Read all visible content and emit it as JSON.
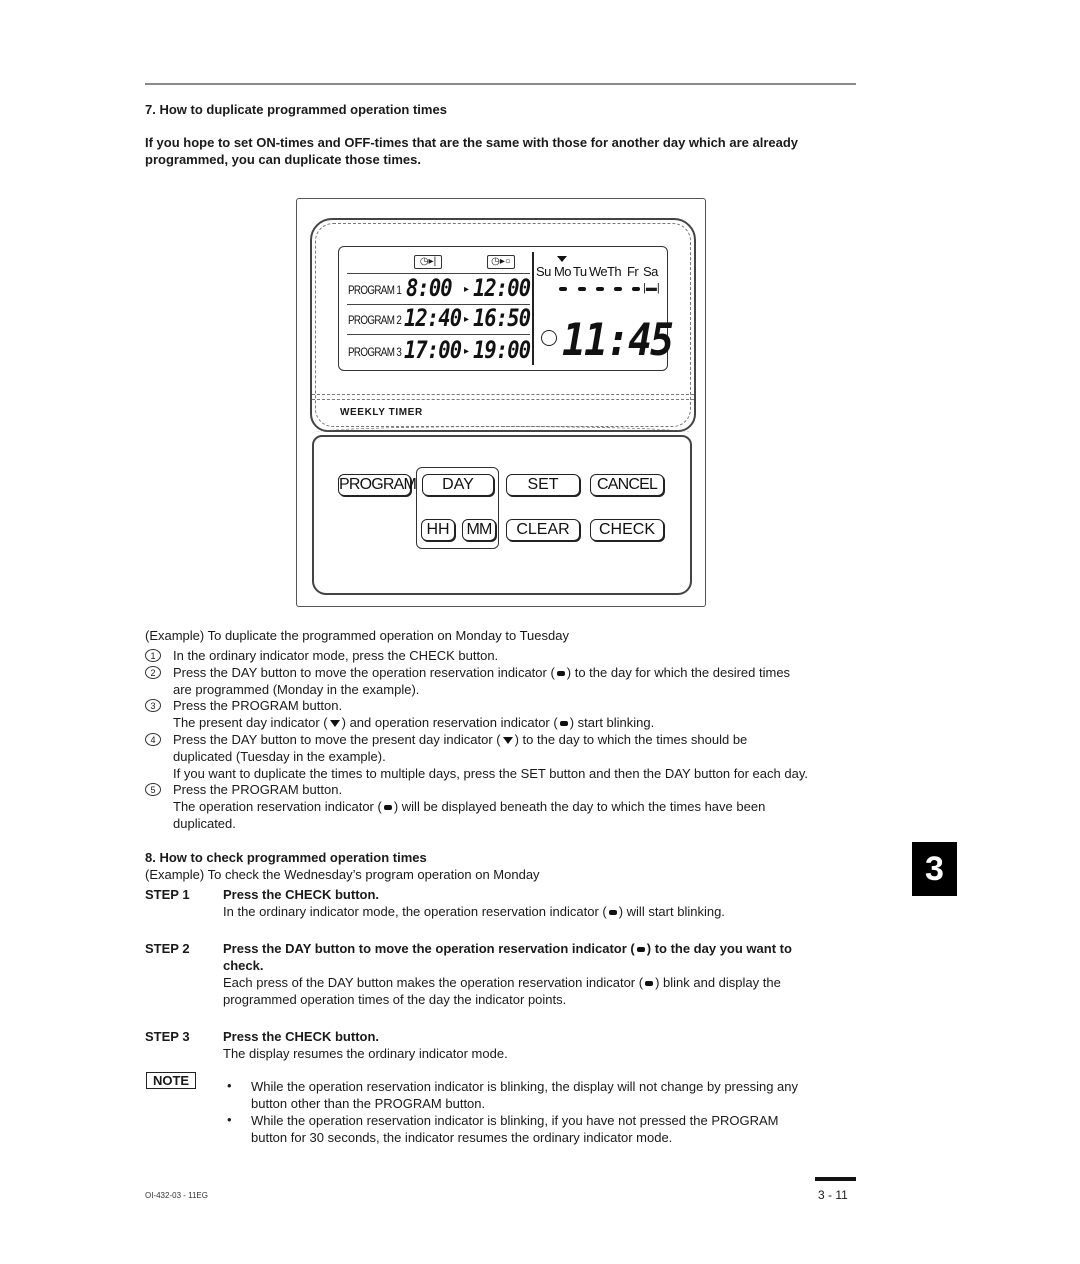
{
  "section7": {
    "heading": "7.   How to duplicate programmed operation times",
    "intro": "If you hope to set ON-times and OFF-times that are the same with those for another day which are already programmed, you can duplicate those times."
  },
  "device": {
    "lcd": {
      "on_icon": "clock-on-icon",
      "off_icon": "clock-off-icon",
      "on_icon_glyph": "◷▸|",
      "off_icon_glyph": "◷▸○",
      "programs": [
        {
          "label": "PROGRAM 1",
          "on": "8:00",
          "off": "12:00"
        },
        {
          "label": "PROGRAM 2",
          "on": "12:40",
          "off": "16:50"
        },
        {
          "label": "PROGRAM 3",
          "on": "17:00",
          "off": "19:00"
        }
      ],
      "arrow": "▸",
      "days": [
        "Su",
        "Mo",
        "Tu",
        "We",
        "Th",
        "Fr",
        "Sa"
      ],
      "present_day": "Mo",
      "reservation_days": [
        "Mo",
        "Tu",
        "We",
        "Th",
        "Fr"
      ],
      "sa_indicator": "|▬|",
      "clock": "11:45"
    },
    "brand_label": "WEEKLY TIMER",
    "buttons": {
      "program": "PROGRAM",
      "day": "DAY",
      "set": "SET",
      "cancel": "CANCEL",
      "hh": "HH",
      "mm": "MM",
      "clear": "CLEAR",
      "check": "CHECK"
    }
  },
  "example7": {
    "intro": "(Example) To duplicate the programmed operation on Monday to Tuesday",
    "steps": [
      {
        "num": "1",
        "lines": [
          "In the ordinary indicator mode, press the CHECK button."
        ]
      },
      {
        "num": "2",
        "lines": [
          "Press the DAY button to move the operation reservation indicator (",
          ") to the day for which the desired times",
          "are programmed (Monday in the example)."
        ]
      },
      {
        "num": "3",
        "lines": [
          "Press the PROGRAM button.",
          "The present day indicator (",
          ") and operation reservation indicator (",
          ") start blinking."
        ]
      },
      {
        "num": "4",
        "lines": [
          "Press the DAY button to move the present day indicator (",
          ") to the day to which the times should be",
          "duplicated (Tuesday in the example).",
          "If you want to duplicate the times to multiple days, press the SET button and then the DAY button for each day."
        ]
      },
      {
        "num": "5",
        "lines": [
          "Press the PROGRAM button.",
          "The operation reservation indicator (",
          ") will be displayed beneath the day to which the times have been",
          "duplicated."
        ]
      }
    ]
  },
  "section8": {
    "heading": "8.   How to check programmed operation times",
    "example": "(Example) To check the Wednesday’s program operation on Monday",
    "steps": [
      {
        "label": "STEP 1",
        "title": "Press the CHECK button.",
        "desc": [
          "In the ordinary indicator mode, the operation reservation indicator (",
          ") will start blinking."
        ]
      },
      {
        "label": "STEP 2",
        "title": [
          "Press the DAY button to move the operation reservation indicator (",
          ") to the day you want to",
          "check."
        ],
        "desc": [
          "Each press of the DAY button makes the operation reservation indicator (",
          ") blink and display the",
          "programmed operation times of the day the indicator points."
        ]
      },
      {
        "label": "STEP 3",
        "title": "Press the CHECK button.",
        "desc": [
          "The display resumes the ordinary indicator mode."
        ]
      }
    ]
  },
  "note": {
    "label": "NOTE",
    "bullets": [
      [
        "While the operation reservation indicator is blinking, the display will not change by pressing any",
        "button other than the PROGRAM button."
      ],
      [
        "While the operation reservation indicator is blinking, if you have not pressed the PROGRAM",
        "button for 30 seconds, the indicator resumes the ordinary indicator mode."
      ]
    ],
    "bullet_glyph": "•"
  },
  "footer": {
    "doc_code": "OI-432-03 - 11EG",
    "page": "3 - 11"
  },
  "chapter_tab": "3",
  "circled": {
    "1": "1",
    "2": "2",
    "3": "3",
    "4": "4",
    "5": "5"
  }
}
